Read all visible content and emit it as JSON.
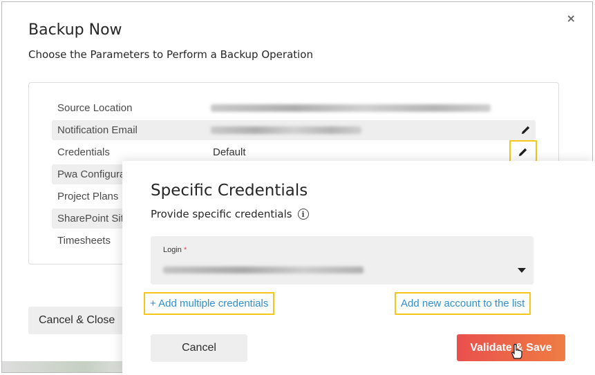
{
  "dialog": {
    "title": "Backup Now",
    "subtitle": "Choose the Parameters to Perform a Backup Operation",
    "close_glyph": "×"
  },
  "params": [
    {
      "label": "Source Location",
      "value_hidden": true
    },
    {
      "label": "Notification Email",
      "value_hidden": true
    },
    {
      "label": "Credentials",
      "value": "Default"
    },
    {
      "label": "Pwa Configuration"
    },
    {
      "label": "Project Plans"
    },
    {
      "label": "SharePoint Sites"
    },
    {
      "label": "Timesheets"
    }
  ],
  "footer": {
    "cancel_close_label": "Cancel & Close"
  },
  "overlay": {
    "title": "Specific Credentials",
    "subtitle": "Provide specific credentials",
    "login_label": "Login",
    "required_mark": "*",
    "add_multiple_label": "+ Add multiple credentials",
    "add_account_label": "Add new account to the list",
    "cancel_label": "Cancel",
    "validate_label": "Validate & Save"
  },
  "icons": {
    "edit": "pencil-icon",
    "info": "info-icon",
    "dropdown": "caret-down-icon",
    "cursor": "hand-pointer-icon",
    "close": "close-icon"
  },
  "colors": {
    "link": "#2d8fd1",
    "highlight": "#f5c518",
    "validate_from": "#e9504d",
    "validate_to": "#ef7d43",
    "required": "#e0474c"
  }
}
